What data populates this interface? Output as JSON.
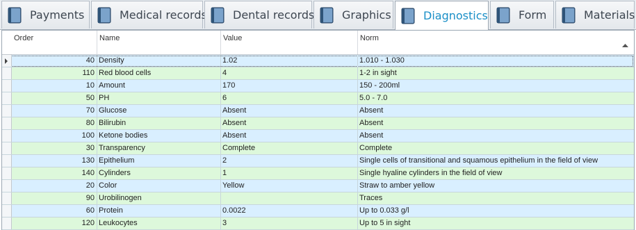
{
  "tabs": [
    {
      "label": "Payments"
    },
    {
      "label": "Medical records"
    },
    {
      "label": "Dental records"
    },
    {
      "label": "Graphics"
    },
    {
      "label": "Diagnostics"
    },
    {
      "label": "Form"
    },
    {
      "label": "Materials"
    }
  ],
  "active_tab": "Diagnostics",
  "colors": {
    "accent": "#1a8fc7",
    "row_blue": "#d9efff",
    "row_green": "#ddf8db"
  },
  "grid": {
    "columns": {
      "order": "Order",
      "name": "Name",
      "value": "Value",
      "norm": "Norm"
    },
    "sorted_column": "Norm",
    "sort_direction": "ascending",
    "rows": [
      {
        "order": "40",
        "name": "Density",
        "value": "1.02",
        "norm": "1.010 - 1.030"
      },
      {
        "order": "110",
        "name": "Red blood cells",
        "value": "4",
        "norm": "1-2 in sight"
      },
      {
        "order": "10",
        "name": "Amount",
        "value": "170",
        "norm": "150 - 200ml"
      },
      {
        "order": "50",
        "name": "PH",
        "value": "6",
        "norm": "5.0 - 7.0"
      },
      {
        "order": "70",
        "name": "Glucose",
        "value": "Absent",
        "norm": "Absent"
      },
      {
        "order": "80",
        "name": "Bilirubin",
        "value": "Absent",
        "norm": "Absent"
      },
      {
        "order": "100",
        "name": "Ketone bodies",
        "value": "Absent",
        "norm": "Absent"
      },
      {
        "order": "30",
        "name": "Transparency",
        "value": "Complete",
        "norm": "Complete"
      },
      {
        "order": "130",
        "name": "Epithelium",
        "value": "2",
        "norm": "Single cells of transitional and squamous epithelium in the field of view"
      },
      {
        "order": "140",
        "name": "Cylinders",
        "value": "1",
        "norm": "Single hyaline cylinders in the field of view"
      },
      {
        "order": "20",
        "name": "Color",
        "value": "Yellow",
        "norm": "Straw to amber yellow"
      },
      {
        "order": "90",
        "name": "Urobilinogen",
        "value": "",
        "norm": "Traces"
      },
      {
        "order": "60",
        "name": "Protein",
        "value": "0.0022",
        "norm": "Up to 0.033 g/l"
      },
      {
        "order": "120",
        "name": "Leukocytes",
        "value": "3",
        "norm": "Up to 5 in sight"
      }
    ]
  }
}
